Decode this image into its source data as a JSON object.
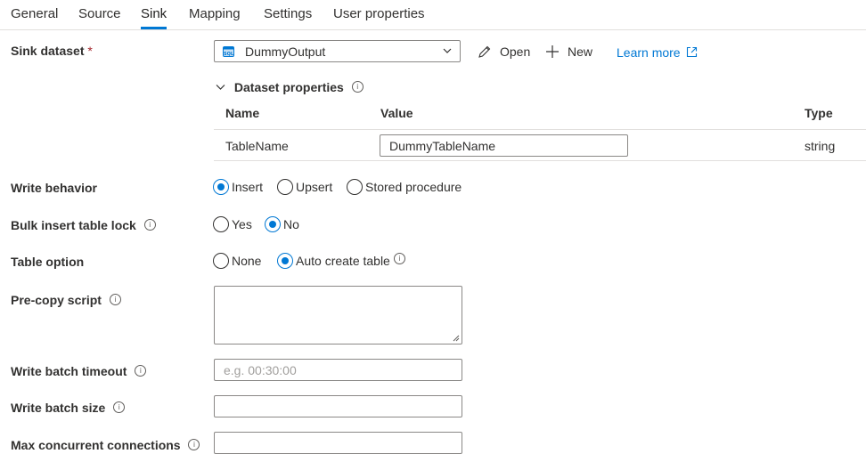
{
  "tabs": [
    {
      "label": "General"
    },
    {
      "label": "Source"
    },
    {
      "label": "Sink"
    },
    {
      "label": "Mapping"
    },
    {
      "label": "Settings"
    },
    {
      "label": "User properties"
    }
  ],
  "active_tab": "Sink",
  "sink_dataset": {
    "label": "Sink dataset",
    "required_mark": "*",
    "selected": "DummyOutput",
    "open_label": "Open",
    "new_label": "New",
    "learn_more_label": "Learn more"
  },
  "dataset_properties": {
    "title": "Dataset properties",
    "columns": [
      "Name",
      "Value",
      "Type"
    ],
    "rows": [
      {
        "name": "TableName",
        "value": "DummyTableName",
        "type": "string"
      }
    ]
  },
  "write_behavior": {
    "label": "Write behavior",
    "options": [
      "Insert",
      "Upsert",
      "Stored procedure"
    ],
    "selected": "Insert"
  },
  "bulk_insert_table_lock": {
    "label": "Bulk insert table lock",
    "options": [
      "Yes",
      "No"
    ],
    "selected": "No"
  },
  "table_option": {
    "label": "Table option",
    "options": [
      "None",
      "Auto create table"
    ],
    "selected": "Auto create table"
  },
  "pre_copy_script": {
    "label": "Pre-copy script",
    "value": ""
  },
  "write_batch_timeout": {
    "label": "Write batch timeout",
    "value": "",
    "placeholder": "e.g. 00:30:00"
  },
  "write_batch_size": {
    "label": "Write batch size",
    "value": ""
  },
  "max_concurrent_connections": {
    "label": "Max concurrent connections",
    "value": ""
  },
  "colors": {
    "accent": "#0078d4",
    "required": "#a4262c",
    "border": "#8a8886"
  }
}
